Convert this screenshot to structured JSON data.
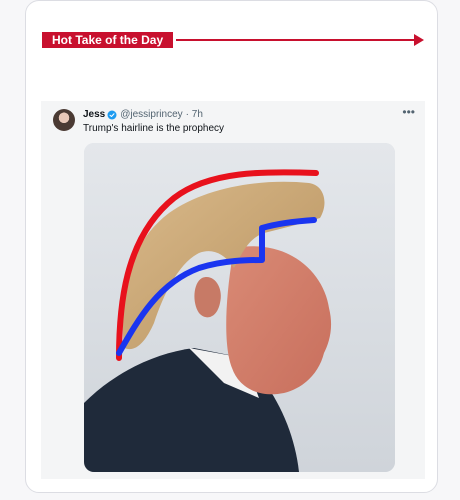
{
  "banner": {
    "label": "Hot Take of the Day",
    "color": "#c8102e"
  },
  "tweet": {
    "name": "Jess",
    "handle": "@jessiprincey",
    "time": "· 7h",
    "text": "Trump's hairline is the prophecy",
    "more_icon": "more-horizontal-icon",
    "verified_icon": "verified-badge-icon",
    "verified_color": "#1d9bf0"
  },
  "media": {
    "description_icon": "photo",
    "red_line_color": "#e8111c",
    "blue_line_color": "#1a35f0"
  }
}
